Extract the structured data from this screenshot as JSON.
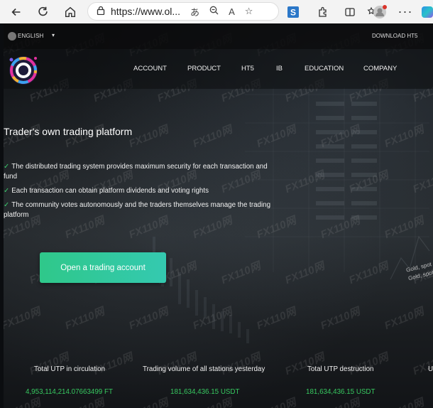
{
  "browser": {
    "url": "https://www.ol...",
    "read_aloud_icon_text": "A",
    "translate_icon_text": "あ"
  },
  "topbar": {
    "language": "ENGLISH",
    "download": "DOWNLOAD HT5"
  },
  "nav": {
    "items": [
      "ACCOUNT",
      "PRODUCT",
      "HT5",
      "IB",
      "EDUCATION",
      "COMPANY"
    ]
  },
  "hero": {
    "title": "Trader's own trading platform",
    "features": [
      "The distributed trading system provides maximum security for each transaction and fund",
      "Each transaction can obtain platform dividends and voting rights",
      "The community votes autonomously and the traders themselves manage the trading platform"
    ],
    "cta": "Open a trading account"
  },
  "stats": {
    "items": [
      {
        "label": "Total UTP in circulation",
        "value": "4,953,114,214.07663499 FT"
      },
      {
        "label": "Trading volume of all stations yesterday",
        "value": "181,634,436.15 USDT"
      },
      {
        "label": "Total UTP destruction",
        "value": "181,634,436.15 USDT"
      },
      {
        "label": "U",
        "value": ""
      }
    ]
  },
  "background_ticker": {
    "line1": "Gold, spot",
    "line2": "Gold, spot (Bid),"
  },
  "watermark_text": "FX110网",
  "colors": {
    "accent_green": "#37c960",
    "cta_start": "#2fc88a",
    "cta_end": "#34c9b0"
  }
}
